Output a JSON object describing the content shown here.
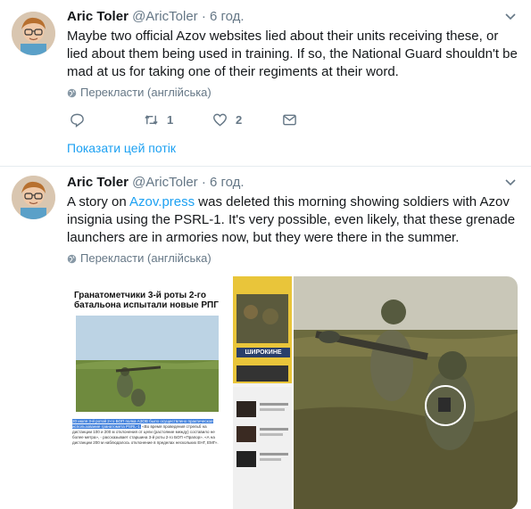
{
  "tweets": [
    {
      "name": "Aric Toler",
      "handle": "@AricToler",
      "separator": "·",
      "time": "6 год.",
      "text": "Maybe two official Azov websites lied about their units receiving these, or lied about them being used in training. If so, the National Guard shouldn't be mad at us for taking one of their regiments at their word.",
      "translate": "Перекласти (англійська)",
      "reply_count": "",
      "retweet_count": "1",
      "like_count": "2",
      "show_thread": "Показати цей потік"
    },
    {
      "name": "Aric Toler",
      "handle": "@AricToler",
      "separator": "·",
      "time": "6 год.",
      "text_before": "A story on ",
      "link": "Azov.press",
      "text_after": " was deleted this morning showing soldiers with Azov insignia using the PSRL-1.  It's very possible, even likely, that these grenade launchers are in armories now, but they were there in the summer.",
      "translate": "Перекласти (англійська)",
      "media": {
        "article_title": "Гранатометчики 3-й роты 2-го батальона испытали новые РПГ",
        "caption_highlight": "20 июля 3-й ротой 2-го БОП полка АЗОВ было осуществлено практическое использование гранатомета PSRL-1.",
        "caption_rest": "«Во время проведения стрельб на дистанции 100 и 200 м отклонения от цели (растояние между) составило не более метра», - рассказывает старшина 3-й роты 2-го БОП «Прапор». «А на дистанции 200 м наблюдалось отклонение в пределах нескольких ЕНГ, ЕМГ».",
        "magazine_title": "ШИРОКИНЕ"
      }
    }
  ],
  "colors": {
    "accent": "#1da1f2",
    "secondary_text": "#657786",
    "primary_text": "#14171a",
    "divider": "#e6ecf0"
  },
  "icons": [
    "caret-down-icon",
    "globe-icon",
    "reply-icon",
    "retweet-icon",
    "like-icon",
    "message-icon"
  ]
}
